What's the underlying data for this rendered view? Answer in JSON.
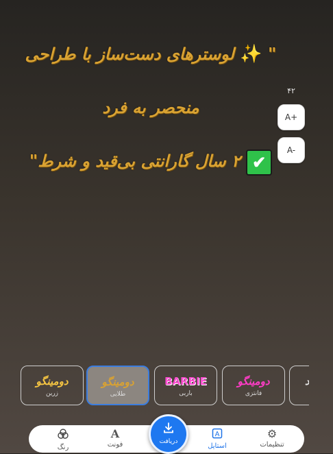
{
  "quote": {
    "line1_start": "\"",
    "line1_sparkle": "✨",
    "line1_text": "لوسترهای دست‌ساز با طراحی",
    "line2_text": "منحصر به فرد",
    "line3_check": "✔",
    "line3_text": "۲ سال گارانتی بی‌قید و شرط\""
  },
  "font_size_control": {
    "value": "۴۲",
    "increase_label": "A+",
    "decrease_label": "A-"
  },
  "styles": [
    {
      "preview": "دومینگو",
      "label": "زرین",
      "color": "#f5c542"
    },
    {
      "preview": "دومینگو",
      "label": "طلایی",
      "color": "#d9a232",
      "selected": true
    },
    {
      "preview": "BARBIE",
      "label": "باربی",
      "color": "#ff4fd2"
    },
    {
      "preview": "دومینگو",
      "label": "فانتزی",
      "color": "#ff3cc7"
    },
    {
      "preview": "د",
      "label": "",
      "color": "#e6e6e6"
    }
  ],
  "bottom_nav": {
    "settings": "تنظیمات",
    "style": "استایل",
    "download": "دریافت",
    "font": "فونت",
    "color": "رنگ"
  }
}
